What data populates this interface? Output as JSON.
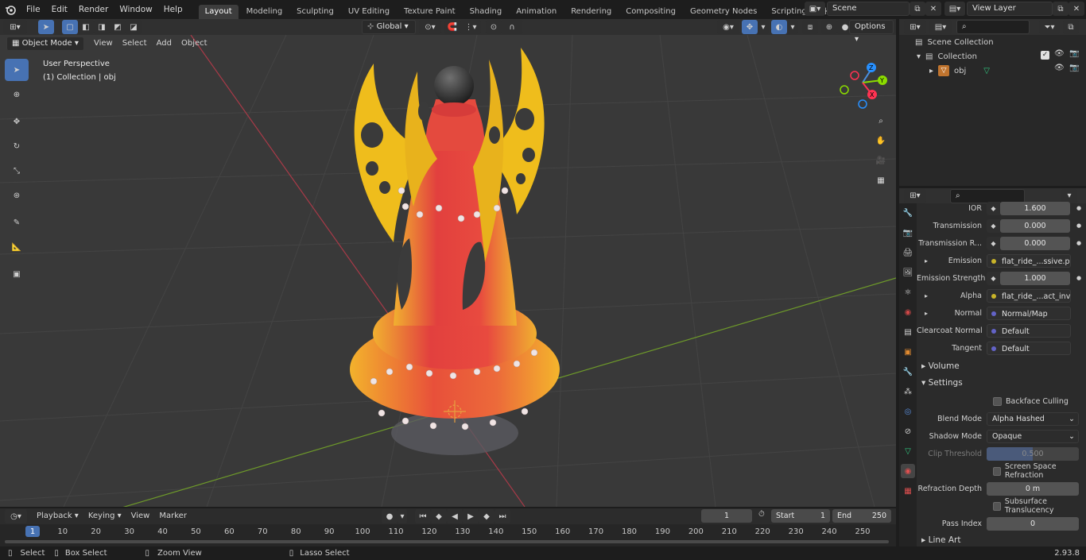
{
  "menubar": {
    "items": [
      "File",
      "Edit",
      "Render",
      "Window",
      "Help"
    ],
    "workspaces": [
      "Layout",
      "Modeling",
      "Sculpting",
      "UV Editing",
      "Texture Paint",
      "Shading",
      "Animation",
      "Rendering",
      "Compositing",
      "Geometry Nodes",
      "Scripting"
    ],
    "active_workspace": "Layout",
    "add_tab": "+",
    "scene": "Scene",
    "view_layer": "View Layer"
  },
  "viewport_header": {
    "mode": "Object Mode",
    "menus": [
      "View",
      "Select",
      "Add",
      "Object"
    ],
    "transform_orientation": "Global",
    "options": "Options"
  },
  "viewport": {
    "perspective": "User Perspective",
    "collection": "(1) Collection | obj",
    "gizmo_axes": [
      "X",
      "Y",
      "Z"
    ]
  },
  "outliner": {
    "root": "Scene Collection",
    "collection": "Collection",
    "object": "obj"
  },
  "properties": {
    "rows": [
      {
        "label": "IOR",
        "value": "1.600",
        "kind": "num"
      },
      {
        "label": "Transmission",
        "value": "0.000",
        "kind": "num"
      },
      {
        "label": "Transmission R...",
        "value": "0.000",
        "kind": "num"
      },
      {
        "label": "Emission",
        "value": "flat_ride_...ssive.png",
        "kind": "tex",
        "color": "#c9b429",
        "expand": true
      },
      {
        "label": "Emission Strength",
        "value": "1.000",
        "kind": "num"
      },
      {
        "label": "Alpha",
        "value": "flat_ride_...act_inv.png",
        "kind": "tex",
        "color": "#c9b429",
        "expand": true
      },
      {
        "label": "Normal",
        "value": "Normal/Map",
        "kind": "tex",
        "color": "#6363c7",
        "expand": true
      },
      {
        "label": "Clearcoat Normal",
        "value": "Default",
        "kind": "tex",
        "color": "#6363c7"
      },
      {
        "label": "Tangent",
        "value": "Default",
        "kind": "tex",
        "color": "#6363c7"
      }
    ],
    "volume": "Volume",
    "settings": "Settings",
    "backface_culling": "Backface Culling",
    "blend_mode_label": "Blend Mode",
    "blend_mode": "Alpha Hashed",
    "shadow_mode_label": "Shadow Mode",
    "shadow_mode": "Opaque",
    "clip_threshold_label": "Clip Threshold",
    "clip_threshold": "0.500",
    "screen_space_refraction": "Screen Space Refraction",
    "refraction_depth_label": "Refraction Depth",
    "refraction_depth": "0 m",
    "subsurface_translucency": "Subsurface Translucency",
    "pass_index_label": "Pass Index",
    "pass_index": "0",
    "line_art": "Line Art"
  },
  "timeline": {
    "menus": [
      "Playback",
      "Keying",
      "View",
      "Marker"
    ],
    "current_frame": "1",
    "start_label": "Start",
    "start": "1",
    "end_label": "End",
    "end": "250",
    "ruler": [
      "1",
      "10",
      "20",
      "30",
      "40",
      "50",
      "60",
      "70",
      "80",
      "90",
      "100",
      "110",
      "120",
      "130",
      "140",
      "150",
      "160",
      "170",
      "180",
      "190",
      "200",
      "210",
      "220",
      "230",
      "240",
      "250"
    ]
  },
  "statusbar": {
    "select": "Select",
    "box_select": "Box Select",
    "zoom_view": "Zoom View",
    "lasso_select": "Lasso Select",
    "version": "2.93.8"
  },
  "colors": {
    "accent": "#4772b3",
    "x_axis": "#ff3352",
    "y_axis": "#8bdc00",
    "z_axis": "#2890ff"
  }
}
